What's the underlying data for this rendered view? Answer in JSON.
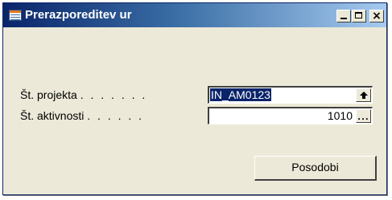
{
  "window": {
    "title": "Prerazporeditev ur",
    "title_icon": "table-form-icon",
    "controls": {
      "minimize_icon": "minimize-icon",
      "maximize_icon": "maximize-icon",
      "close_icon": "close-icon",
      "close_glyph": "×"
    }
  },
  "form": {
    "project": {
      "label": "Št. projekta",
      "leader": ". . . . . . .",
      "value": "IN_AM0123",
      "button_icon": "lookup-arrow-icon"
    },
    "activity": {
      "label": "Št. aktivnosti",
      "leader": ". . . . . .",
      "value": "1010",
      "button_icon": "ellipsis-icon",
      "button_text": "..."
    }
  },
  "actions": {
    "update_label": "Posodobi"
  },
  "colors": {
    "titlebar_start": "#0a246a",
    "titlebar_end": "#a6caf0",
    "window_bg": "#ece9d8",
    "selection": "#0a246a"
  }
}
